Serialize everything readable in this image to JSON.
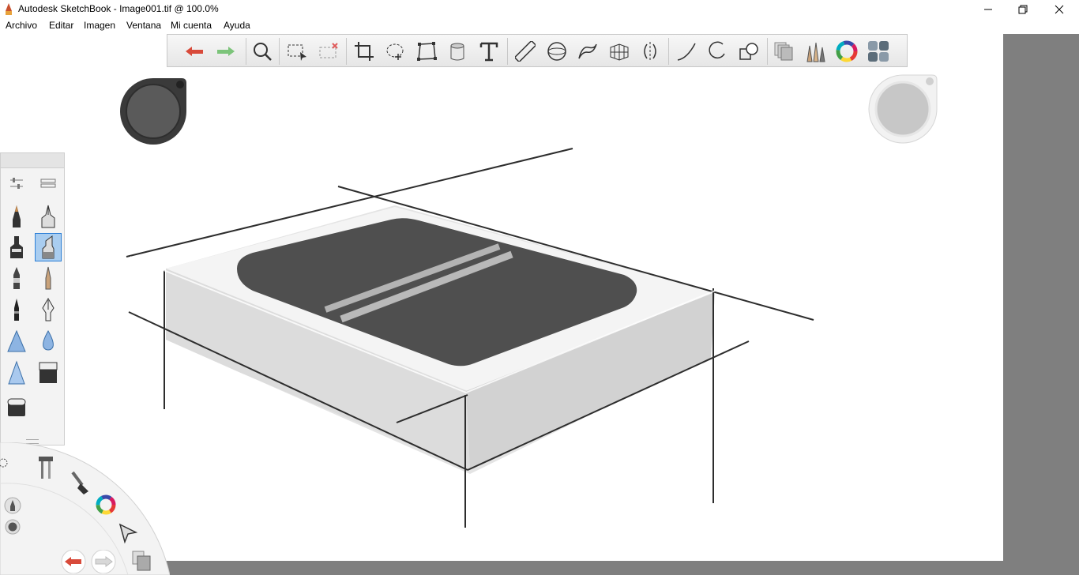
{
  "window": {
    "title": "Autodesk SketchBook - Image001.tif @ 100.0%"
  },
  "menu": [
    "Archivo",
    "Editar",
    "Imagen",
    "Ventana",
    "Mi cuenta",
    "Ayuda"
  ],
  "toolbar": {
    "groups": [
      [
        "undo-icon",
        "redo-icon"
      ],
      [
        "zoom-icon"
      ],
      [
        "select-icon",
        "clear-selection-icon"
      ],
      [
        "crop-icon",
        "lasso-icon",
        "transform-icon",
        "fill-icon",
        "text-icon"
      ],
      [
        "ruler-icon",
        "ellipse-guide-icon",
        "french-curve-icon",
        "perspective-icon",
        "symmetry-icon"
      ],
      [
        "line-icon",
        "circle-icon",
        "shapes-icon"
      ],
      [
        "layers-icon",
        "brushes-icon",
        "color-wheel-icon",
        "copic-library-icon"
      ]
    ]
  },
  "pucks": {
    "left_color": "#5a5a5a",
    "right_color": "#c7c7c7"
  },
  "brush_palette": {
    "brushes": [
      "pencil-icon",
      "technical-pen-icon",
      "marker-icon",
      "chisel-marker-icon",
      "felt-pen-icon",
      "fine-brush-icon",
      "ink-pen-icon",
      "fountain-pen-icon",
      "airbrush-icon",
      "water-drop-icon",
      "smudge-icon",
      "hard-eraser-icon",
      "soft-eraser-icon"
    ],
    "selected_index": 3
  },
  "lagoon": {
    "items": [
      "settings-icon",
      "tools-icon",
      "brush-icon",
      "color-icon",
      "select-icon",
      "layers-icon",
      "undo-icon",
      "redo-icon",
      "pen-icon",
      "circle-icon"
    ]
  },
  "colors": {
    "accent": "#2d7fd6",
    "undo": "#d84a3a",
    "redo": "#7cc47a",
    "workspace": "#7f7f7f"
  }
}
